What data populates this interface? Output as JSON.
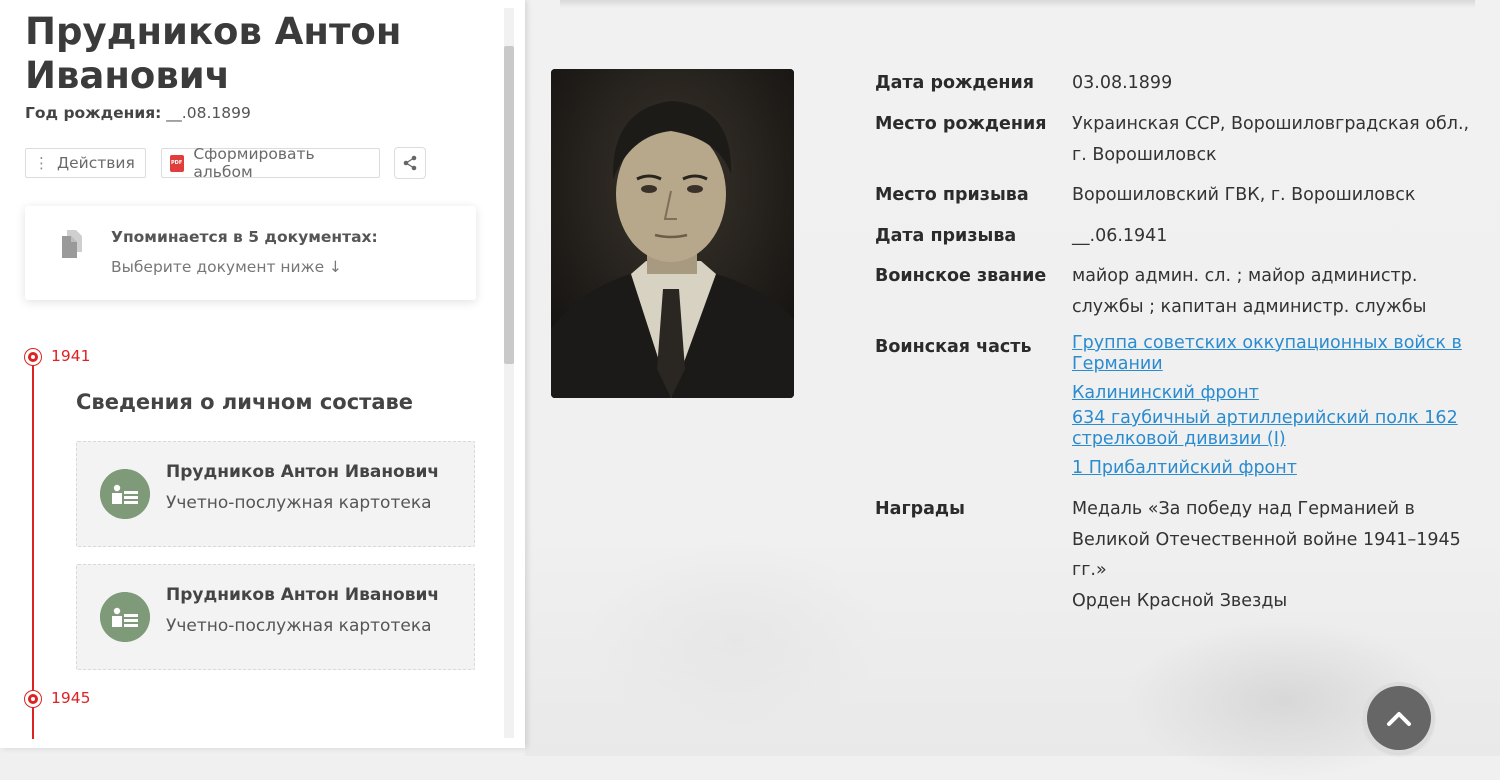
{
  "person": {
    "name": "Прудников Антон Иванович",
    "birth_label": "Год рождения:",
    "birth_value": "__.08.1899"
  },
  "toolbar": {
    "actions_label": "Действия",
    "album_label": "Сформировать альбом"
  },
  "mentions": {
    "title": "Упоминается в 5 документах:",
    "subtitle": "Выберите документ ниже ↓"
  },
  "timeline": {
    "start_year": "1941",
    "end_year": "1945",
    "section_title": "Сведения о личном составе",
    "records": [
      {
        "name": "Прудников Антон Иванович",
        "type": "Учетно-послужная картотека"
      },
      {
        "name": "Прудников Антон Иванович",
        "type": "Учетно-послужная картотека"
      }
    ]
  },
  "details": {
    "birth_date_label": "Дата рождения",
    "birth_date": "03.08.1899",
    "birth_place_label": "Место рождения",
    "birth_place": "Украинская ССР, Ворошиловградская обл., г. Ворошиловск",
    "draft_place_label": "Место призыва",
    "draft_place": "Ворошиловский ГВК, г. Ворошиловск",
    "draft_date_label": "Дата призыва",
    "draft_date": "__.06.1941",
    "rank_label": "Воинское звание",
    "rank": "майор админ. сл. ; майор администр. службы ; капитан администр. службы",
    "unit_label": "Воинская часть",
    "units": [
      "Группа советских оккупационных войск в Германии",
      "Калининский фронт",
      "634 гаубичный артиллерийский полк 162 стрелковой дивизии (I)",
      "1 Прибалтийский фронт"
    ],
    "awards_label": "Награды",
    "awards": [
      "Медаль «За победу над Германией в Великой Отечественной войне 1941–1945 гг.»",
      "Орден Красной Звезды"
    ]
  },
  "icons": {
    "share": "share-icon",
    "documents": "documents-icon",
    "record": "record-card-icon",
    "scroll_top": "chevron-up-icon"
  },
  "colors": {
    "accent_red": "#dd2222",
    "link_blue": "#2a8ccf",
    "record_icon_green": "#7e9a78"
  }
}
